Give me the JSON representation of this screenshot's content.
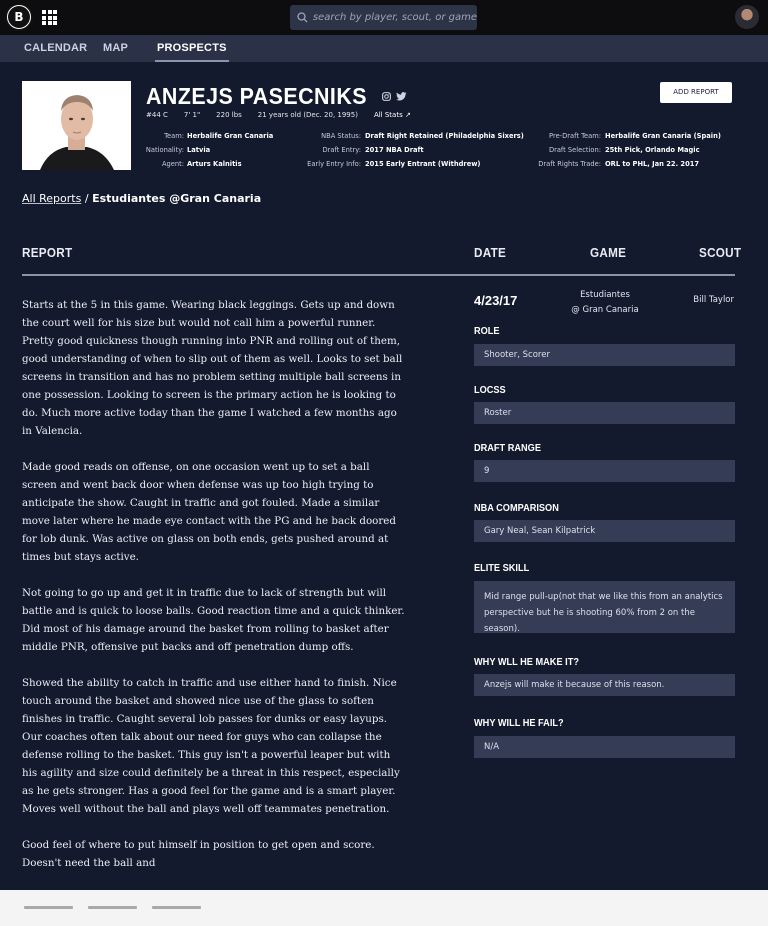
{
  "header": {
    "logo_text": "B",
    "search_placeholder": "search by player, scout, or game"
  },
  "nav": {
    "items": [
      {
        "label": "CALENDAR"
      },
      {
        "label": "MAP"
      },
      {
        "label": "PROSPECTS",
        "active": true
      }
    ]
  },
  "player": {
    "name": "ANZEJS PASECNIKS",
    "number_position": "#44 C",
    "height": "7' 1\"",
    "weight": "220 lbs",
    "age": "21 years old (Dec. 20, 1995)",
    "all_stats_label": "All Stats ↗",
    "add_report_label": "ADD REPORT",
    "info": {
      "team_label": "Team:",
      "team": "Herbalife Gran Canaria",
      "nationality_label": "Nationality:",
      "nationality": "Latvia",
      "agent_label": "Agent:",
      "agent": "Arturs Kalnitis",
      "nba_status_label": "NBA Status:",
      "nba_status": "Draft Right Retained (Philadelphia Sixers)",
      "draft_entry_label": "Draft Entry:",
      "draft_entry": "2017 NBA Draft",
      "early_entry_label": "Early Entry Info:",
      "early_entry": "2015 Early Entrant (Withdrew)",
      "pre_draft_team_label": "Pre-Draft Team:",
      "pre_draft_team": "Herbalife Gran Canaria (Spain)",
      "draft_selection_label": "Draft Selection:",
      "draft_selection": "25th Pick, Orlando Magic",
      "draft_rights_trade_label": "Draft Rights Trade:",
      "draft_rights_trade": "ORL to PHL, Jan 22. 2017"
    }
  },
  "breadcrumb": {
    "link": "All Reports",
    "separator": "/",
    "current": "Estudiantes @Gran Canaria"
  },
  "report": {
    "headers": {
      "report": "REPORT",
      "date": "DATE",
      "game": "GAME",
      "scout": "SCOUT"
    },
    "paragraphs": [
      "Starts at the 5 in this game. Wearing black leggings. Gets up and down the court well for his size but would not call him a powerful runner. Pretty good quickness though running into PNR and rolling out of them, good understanding of when to slip out of them as well. Looks to set ball screens in transition and has no problem setting multiple ball screens in one possession. Looking to screen is the primary action he is looking to do. Much more active today than the game I watched a few months ago in Valencia.",
      "Made good reads on offense, on one occasion went up to set a ball screen and went back door when defense was up too high trying to anticipate the show. Caught in traffic and got fouled. Made a similar move later where he made eye contact with the PG and he back doored for lob dunk. Was active on glass on both ends, gets pushed around at times but stays active.",
      "Not going to go up and get it in traffic due to lack of strength but will battle and is quick to loose balls. Good reaction time and a quick thinker. Did most of his damage around the basket from rolling to basket after middle PNR, offensive put backs and off penetration dump offs.",
      "Showed the ability to catch in traffic and use either hand to finish. Nice touch around the basket and showed nice use of the glass to soften finishes in traffic. Caught several lob passes for dunks or easy layups. Our coaches often talk about our need for guys who can collapse the defense rolling to the basket. This guy isn't a powerful leaper but with his agility and size could definitely be a threat in this respect, especially as he gets stronger. Has a good feel for the game and is a smart player. Moves well without the ball and plays well off teammates penetration.",
      "Good feel of where to put himself in position to get open and score. Doesn't need the ball and"
    ],
    "date": "4/23/17",
    "game_line1": "Estudiantes",
    "game_line2": "@ Gran Canaria",
    "scout": "Bill Taylor",
    "fields": [
      {
        "label": "ROLE",
        "value": "Shooter, Scorer"
      },
      {
        "label": "LOCSS",
        "value": "Roster"
      },
      {
        "label": "DRAFT RANGE",
        "value": "9"
      },
      {
        "label": "NBA COMPARISON",
        "value": "Gary Neal, Sean Kilpatrick"
      },
      {
        "label": "ELITE SKILL",
        "value": "Mid range pull-up(not that we like this from an analytics perspective but he is shooting 60% from 2 on the season)."
      },
      {
        "label": "WHY WLL HE MAKE IT?",
        "value": "Anzejs will make it because of this reason."
      },
      {
        "label": "WHY WILL HE FAIL?",
        "value": "N/A"
      }
    ]
  },
  "colors": {
    "background": "#131a2e",
    "topbar": "#0d0d0f",
    "navbar": "#2b3147",
    "field_box": "#353c56",
    "footer": "#f4f4f5"
  }
}
